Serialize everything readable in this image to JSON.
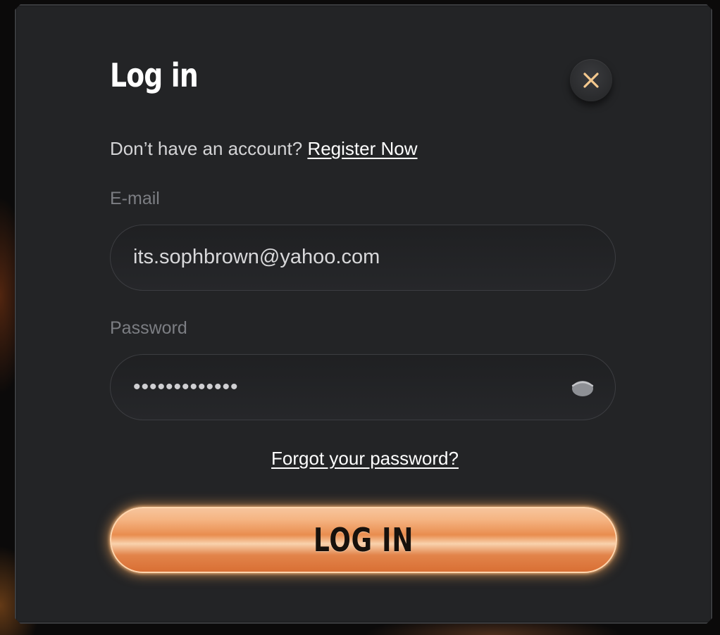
{
  "modal": {
    "title": "Log in",
    "close_icon": "close-icon"
  },
  "register": {
    "prompt": "Don’t have an account?",
    "link_label": "Register Now"
  },
  "email": {
    "label": "E-mail",
    "value": "its.sophbrown@yahoo.com"
  },
  "password": {
    "label": "Password",
    "value": "•••••••••••••",
    "toggle_icon": "eye-icon"
  },
  "forgot": {
    "label": "Forgot your password?"
  },
  "login_button": {
    "label": "LOG IN"
  },
  "colors": {
    "panel": "#232426",
    "accent": "#f0a46a",
    "close_x": "#f5c98e"
  }
}
